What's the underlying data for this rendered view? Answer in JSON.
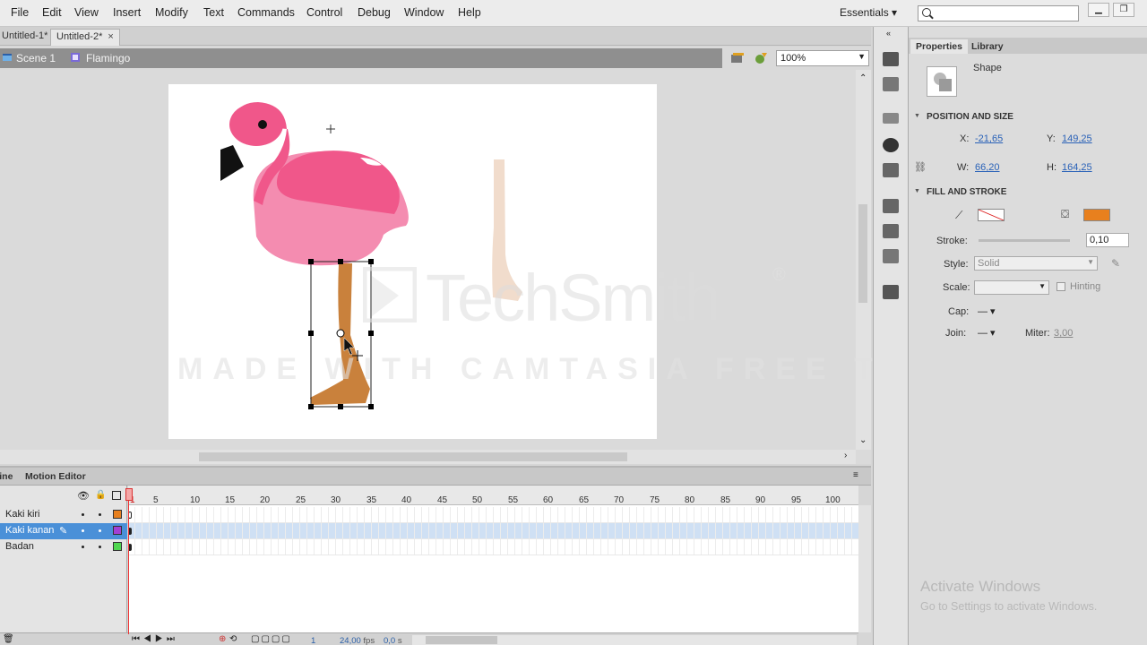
{
  "menu": [
    "File",
    "Edit",
    "View",
    "Insert",
    "Modify",
    "Text",
    "Commands",
    "Control",
    "Debug",
    "Window",
    "Help"
  ],
  "workspace": "Essentials",
  "tabs": [
    "Untitled-1*",
    "Untitled-2*"
  ],
  "breadcrumb": {
    "scene": "Scene 1",
    "symbol": "Flamingo"
  },
  "zoom": "100%",
  "watermark": {
    "brand": "TechSmith",
    "registered": "®",
    "trial": "MADE WITH CAMTASIA FREE TRIAL"
  },
  "timeline": {
    "tabs": [
      "Timeline",
      "Motion Editor"
    ],
    "frame_numbers": [
      "1",
      "5",
      "10",
      "15",
      "20",
      "25",
      "30",
      "35",
      "40",
      "45",
      "50",
      "55",
      "60",
      "65",
      "70",
      "75",
      "80",
      "85",
      "90",
      "95",
      "100"
    ],
    "layers": [
      {
        "name": "Kaki kiri",
        "color": "#e8801e",
        "selected": false
      },
      {
        "name": "Kaki kanan",
        "color": "#a23fd4",
        "selected": true
      },
      {
        "name": "Badan",
        "color": "#4fd64f",
        "selected": false
      }
    ],
    "current_frame": "1",
    "fps": "24,00",
    "fps_unit": "fps",
    "time": "0,0",
    "time_unit": "s"
  },
  "properties": {
    "tabs": [
      "Properties",
      "Library"
    ],
    "type": "Shape",
    "position_size_title": "POSITION AND SIZE",
    "x_label": "X:",
    "x": "-21,65",
    "y_label": "Y:",
    "y": "149,25",
    "w_label": "W:",
    "w": "66,20",
    "h_label": "H:",
    "h": "164,25",
    "fill_stroke_title": "FILL AND STROKE",
    "fill_color": "#e8801e",
    "stroke_label": "Stroke:",
    "stroke_value": "0,10",
    "style_label": "Style:",
    "style_value": "Solid",
    "scale_label": "Scale:",
    "hinting": "Hinting",
    "cap_label": "Cap:",
    "join_label": "Join:",
    "miter_label": "Miter:",
    "miter_value": "3,00"
  },
  "activation": {
    "title": "Activate Windows",
    "subtitle": "Go to Settings to activate Windows."
  }
}
